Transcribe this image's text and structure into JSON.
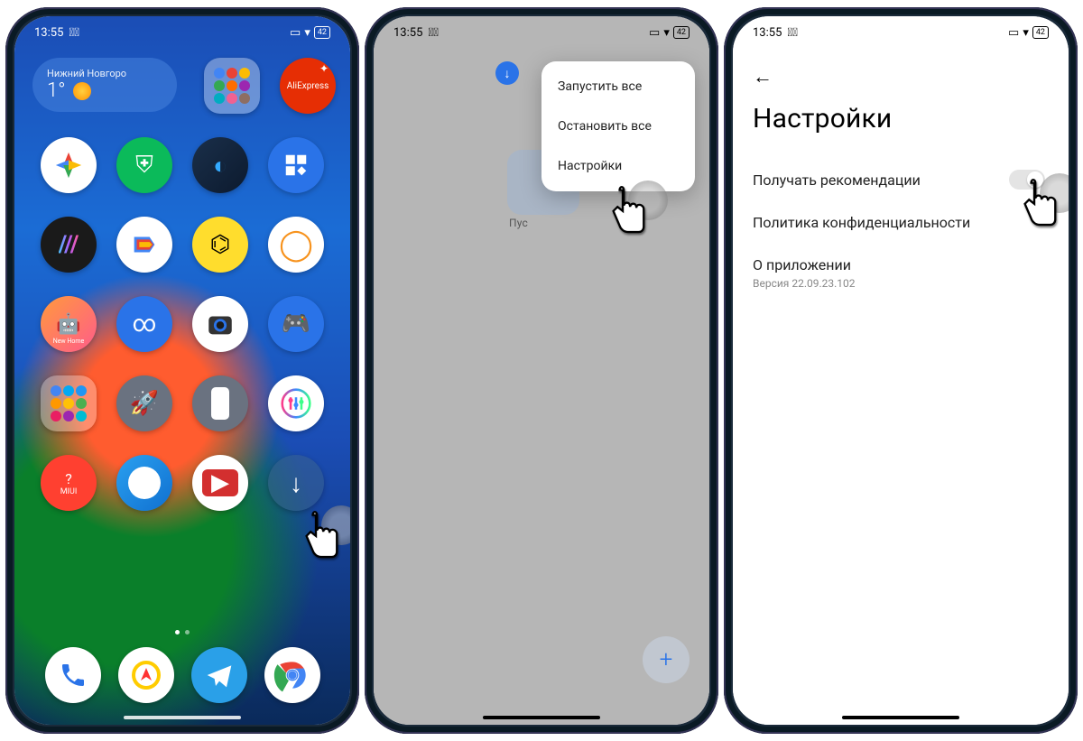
{
  "status": {
    "time": "13:55",
    "battery": "42"
  },
  "phone1": {
    "weather": {
      "city": "Нижний Новгоро",
      "temp": "1°"
    },
    "apps": {
      "ali": "AliExpress",
      "newhome": "New Home",
      "miui": "MIUI"
    }
  },
  "phone2": {
    "folder_label": "Пус",
    "menu": {
      "start_all": "Запустить все",
      "stop_all": "Остановить все",
      "settings": "Настройки"
    }
  },
  "phone3": {
    "title": "Настройки",
    "recommend": "Получать рекомендации",
    "privacy": "Политика конфиденциальности",
    "about": "О приложении",
    "version": "Версия 22.09.23.102"
  }
}
